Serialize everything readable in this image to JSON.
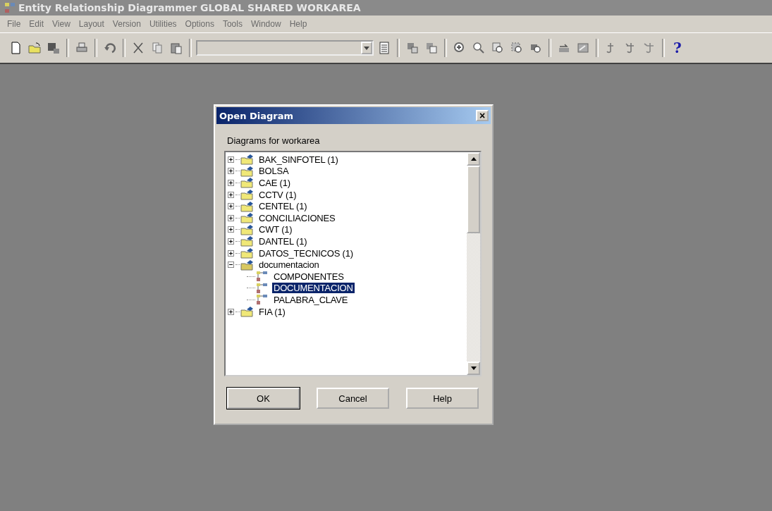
{
  "window": {
    "title": "Entity Relationship Diagrammer GLOBAL SHARED WORKAREA"
  },
  "menu": [
    "File",
    "Edit",
    "View",
    "Layout",
    "Version",
    "Utilities",
    "Options",
    "Tools",
    "Window",
    "Help"
  ],
  "toolbar": {
    "help_glyph": "?"
  },
  "dialog": {
    "title": "Open Diagram",
    "close_glyph": "×",
    "label": "Diagrams for workarea",
    "tree": [
      {
        "kind": "folder",
        "label": "BAK_SINFOTEL (1)",
        "expanded": false,
        "selected": false
      },
      {
        "kind": "folder",
        "label": "BOLSA",
        "expanded": false,
        "selected": false
      },
      {
        "kind": "folder",
        "label": "CAE (1)",
        "expanded": false,
        "selected": false
      },
      {
        "kind": "folder",
        "label": "CCTV (1)",
        "expanded": false,
        "selected": false
      },
      {
        "kind": "folder",
        "label": "CENTEL (1)",
        "expanded": false,
        "selected": false
      },
      {
        "kind": "folder",
        "label": "CONCILIACIONES",
        "expanded": false,
        "selected": false
      },
      {
        "kind": "folder",
        "label": "CWT (1)",
        "expanded": false,
        "selected": false
      },
      {
        "kind": "folder",
        "label": "DANTEL (1)",
        "expanded": false,
        "selected": false
      },
      {
        "kind": "folder",
        "label": "DATOS_TECNICOS (1)",
        "expanded": false,
        "selected": false
      },
      {
        "kind": "folder",
        "label": "documentacion",
        "expanded": true,
        "selected": false,
        "children": [
          {
            "kind": "diagram",
            "label": "COMPONENTES",
            "selected": false
          },
          {
            "kind": "diagram",
            "label": "DOCUMENTACION",
            "selected": true
          },
          {
            "kind": "diagram",
            "label": "PALABRA_CLAVE",
            "selected": false
          }
        ]
      },
      {
        "kind": "folder",
        "label": "FIA (1)",
        "expanded": false,
        "selected": false
      }
    ],
    "buttons": [
      "OK",
      "Cancel",
      "Help"
    ]
  }
}
